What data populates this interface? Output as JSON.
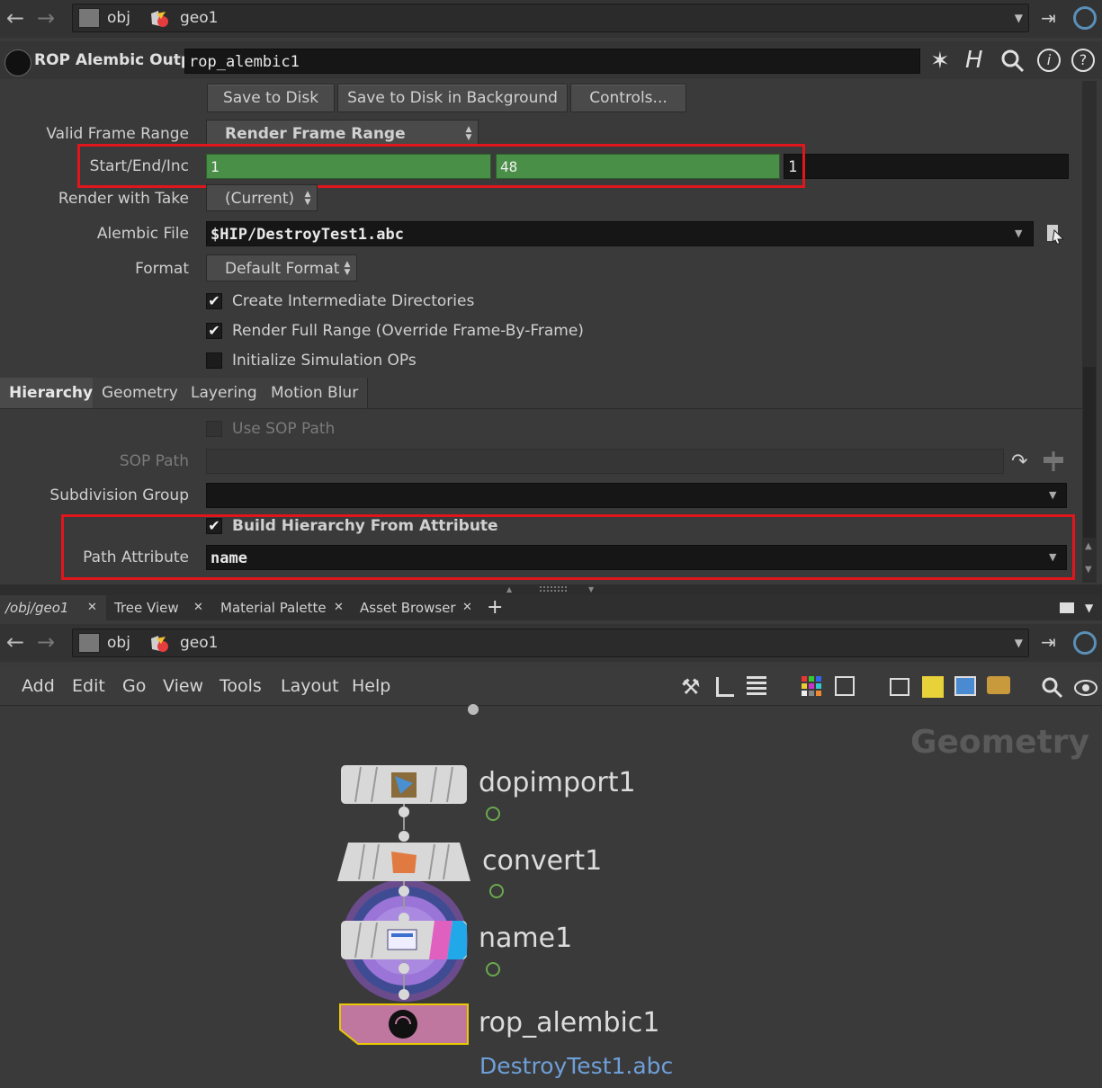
{
  "top_pathbar": {
    "crumbs": [
      "obj",
      "geo1"
    ]
  },
  "parm_header": {
    "node_type": "ROP Alembic Output",
    "node_name": "rop_alembic1"
  },
  "buttons": {
    "save_to_disk": "Save to Disk",
    "save_background": "Save to Disk in Background",
    "controls": "Controls..."
  },
  "parms": {
    "valid_frame_range": {
      "label": "Valid Frame Range",
      "value": "Render Frame Range"
    },
    "start_end_inc": {
      "label": "Start/End/Inc",
      "start": "1",
      "end": "48",
      "inc": "1"
    },
    "render_with_take": {
      "label": "Render with Take",
      "value": "(Current)"
    },
    "alembic_file": {
      "label": "Alembic File",
      "value": "$HIP/DestroyTest1.abc"
    },
    "format": {
      "label": "Format",
      "value": "Default Format"
    },
    "create_dirs": {
      "label": "Create Intermediate Directories",
      "checked": true
    },
    "render_full_range": {
      "label": "Render Full Range (Override Frame-By-Frame)",
      "checked": true
    },
    "init_sim_ops": {
      "label": "Initialize Simulation OPs",
      "checked": false
    }
  },
  "parm_tabs": [
    "Hierarchy",
    "Geometry",
    "Layering",
    "Motion Blur"
  ],
  "hierarchy": {
    "use_sop_path": {
      "label": "Use SOP Path",
      "checked": false
    },
    "sop_path": {
      "label": "SOP Path",
      "value": ""
    },
    "subdivision_group": {
      "label": "Subdivision Group",
      "value": ""
    },
    "build_hierarchy": {
      "label": "Build Hierarchy From Attribute",
      "checked": true
    },
    "path_attribute": {
      "label": "Path Attribute",
      "value": "name"
    }
  },
  "pane_tabs": [
    "/obj/geo1",
    "Tree View",
    "Material Palette",
    "Asset Browser"
  ],
  "network_pathbar": {
    "crumbs": [
      "obj",
      "geo1"
    ]
  },
  "network_menu": [
    "Add",
    "Edit",
    "Go",
    "View",
    "Tools",
    "Layout",
    "Help"
  ],
  "network": {
    "context_label": "Geometry",
    "nodes": [
      {
        "name": "dopimport1"
      },
      {
        "name": "convert1"
      },
      {
        "name": "name1"
      },
      {
        "name": "rop_alembic1",
        "subtitle": "DestroyTest1.abc"
      }
    ]
  },
  "colors": {
    "green_field": "#4a8f47",
    "highlight_red": "#e0161c",
    "rop_node": "#c0779f",
    "selected_outline": "#e8c800",
    "file_link": "#6f9fd8"
  }
}
